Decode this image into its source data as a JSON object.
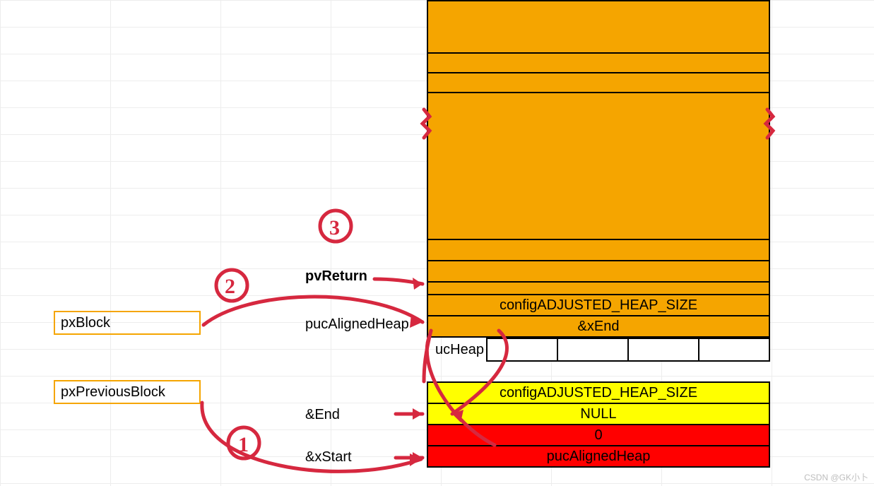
{
  "labels": {
    "pxBlock": "pxBlock",
    "pxPreviousBlock": "pxPreviousBlock",
    "pvReturn": "pvReturn",
    "pucAlignedHeap": "pucAlignedHeap",
    "ucHeap": "ucHeap",
    "ampEnd": "&End",
    "ampXStart": "&xStart"
  },
  "cells": {
    "configAdjustedHeapSize_top": "configADJUSTED_HEAP_SIZE",
    "xEnd_addr": "&xEnd",
    "configAdjustedHeapSize_yellow": "configADJUSTED_HEAP_SIZE",
    "null_yellow": "NULL",
    "zero_red": "0",
    "pucAlignedHeap_red": "pucAlignedHeap"
  },
  "annotations": {
    "n1": "1",
    "n2": "2",
    "n3": "3"
  },
  "watermark": "CSDN @GK小卜"
}
